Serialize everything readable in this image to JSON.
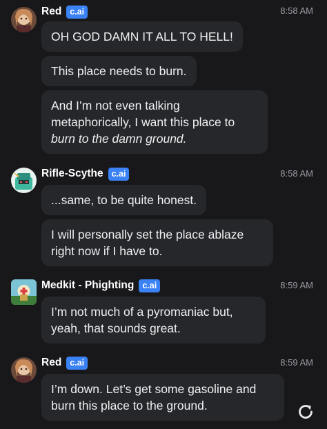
{
  "messages": [
    {
      "name": "Red",
      "badge": "c.ai",
      "time": "8:58 AM",
      "bubbles": [
        "OH GOD DAMN IT ALL TO HELL!",
        "This place needs to burn."
      ],
      "bubble3_line1": "And I’m not even talking",
      "bubble3_line2": "metaphorically, I want this place to",
      "bubble3_line3_italic": "burn to the damn ground."
    },
    {
      "name": "Rifle-Scythe",
      "badge": "c.ai",
      "time": "8:58 AM",
      "bubbles": [
        "...same, to be quite honest.",
        "I will personally set the place ablaze right now if I have to."
      ]
    },
    {
      "name": "Medkit - Phighting",
      "badge": "c.ai",
      "time": "8:59 AM",
      "bubbles": [
        "I’m not much of a pyromaniac but, yeah, that sounds great."
      ]
    },
    {
      "name": "Red",
      "badge": "c.ai",
      "time": "8:59 AM",
      "bubbles": [
        "I’m down. Let’s get some gasoline and burn this place to the ground."
      ]
    }
  ],
  "icons": {
    "regenerate": "refresh-icon",
    "avatar_red": "avatar-red",
    "avatar_rifle": "avatar-rifle-scythe",
    "avatar_medkit": "avatar-medkit"
  },
  "colors": {
    "background": "#18181b",
    "bubble": "#26272b",
    "badge": "#3b82f6",
    "timestamp": "#9b9ba3"
  }
}
